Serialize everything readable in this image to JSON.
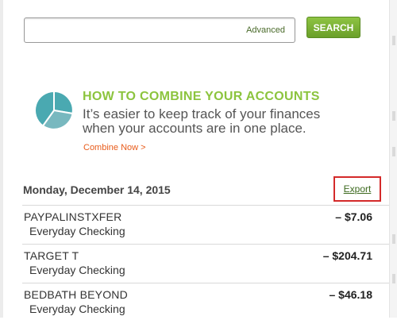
{
  "search": {
    "placeholder": "",
    "advanced_label": "Advanced",
    "button_label": "SEARCH"
  },
  "promo": {
    "title": "HOW TO COMBINE YOUR ACCOUNTS",
    "body": "It’s easier to keep track of your finances when your accounts are in one place.",
    "link_label": "Combine Now >",
    "icon": "pie-chart-icon",
    "colors": {
      "title": "#8cc43e",
      "link": "#e85c1b",
      "icon_teal": "#4aa9b1",
      "icon_light": "#9ad0d4",
      "icon_dark": "#78b8bf"
    }
  },
  "transactions_section": {
    "date": "Monday, December 14, 2015",
    "export_label": "Export",
    "highlight_color": "#d42a2a",
    "items": [
      {
        "name": "PAYPALINSTXFER",
        "account": "Everyday Checking",
        "amount": "– $7.06"
      },
      {
        "name": "TARGET T",
        "account": "Everyday Checking",
        "amount": "– $204.71"
      },
      {
        "name": "BEDBATH BEYOND",
        "account": "Everyday Checking",
        "amount": "– $46.18"
      }
    ]
  },
  "colors": {
    "accent_green": "#6a9f2a"
  }
}
